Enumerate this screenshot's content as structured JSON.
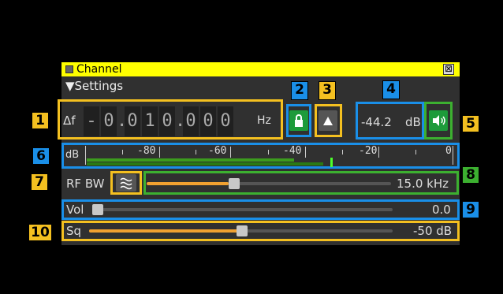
{
  "window": {
    "title": "Channel",
    "close_label": "⊠"
  },
  "settings": {
    "label": "▼Settings"
  },
  "frequency": {
    "delta_label": "Δf",
    "sign": "-",
    "digits": [
      "0",
      "0",
      "1",
      "0",
      "0",
      "0",
      "0"
    ],
    "unit": "Hz"
  },
  "power": {
    "value": "-44.2",
    "unit": "dB"
  },
  "meter": {
    "unit": "dB",
    "ticks": [
      "-80",
      "-60",
      "-40",
      "-20",
      "0"
    ],
    "level_fraction": 0.6
  },
  "rfbw": {
    "label": "RF BW",
    "value": "15.0 kHz",
    "fraction": 0.33
  },
  "volume": {
    "label": "Vol",
    "value": "0.0",
    "fraction": 0.0
  },
  "squelch": {
    "label": "Sq",
    "value": "-50 dB",
    "fraction": 0.5
  },
  "callouts": [
    "1",
    "2",
    "3",
    "4",
    "5",
    "6",
    "7",
    "8",
    "9",
    "10"
  ],
  "colors": {
    "highlight_yellow": "#f4c020",
    "highlight_blue": "#1a8fe8",
    "highlight_green": "#3cb030",
    "title_bar": "#ffff00",
    "slider_fill": "#f0a030"
  }
}
